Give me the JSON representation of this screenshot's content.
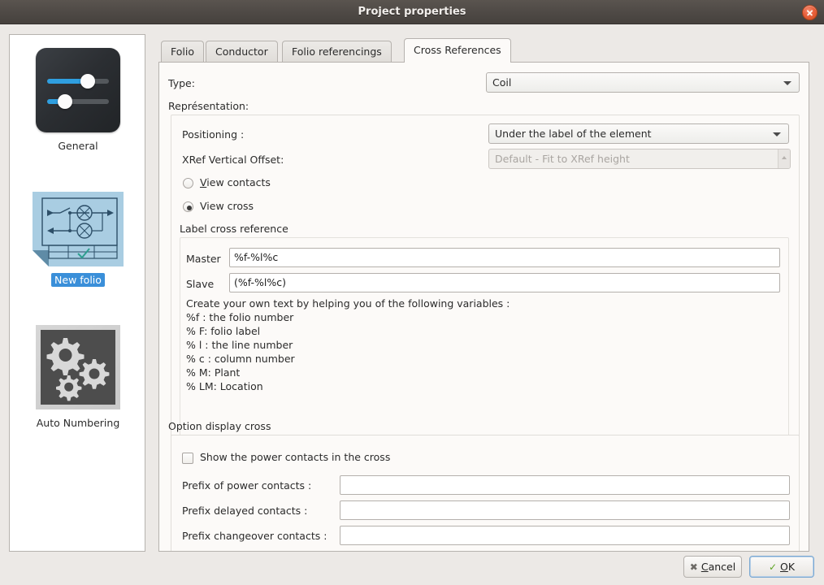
{
  "window": {
    "title": "Project properties",
    "close_icon": "close-icon"
  },
  "sidebar": {
    "items": [
      {
        "label": "General",
        "icon": "sliders-icon",
        "selected": false
      },
      {
        "label": "New folio",
        "icon": "folio-diagram-icon",
        "selected": true
      },
      {
        "label": "Auto Numbering",
        "icon": "gears-icon",
        "selected": false
      }
    ]
  },
  "tabs": [
    {
      "label": "Folio",
      "active": false
    },
    {
      "label": "Conductor",
      "active": false
    },
    {
      "label": "Folio referencings",
      "active": false
    },
    {
      "label": "Cross References",
      "active": true
    }
  ],
  "cross_references": {
    "type_label": "Type:",
    "type_value": "Coil",
    "representation_label": "Représentation:",
    "positioning_label": "Positioning :",
    "positioning_value": "Under the label of the element",
    "xref_offset_label": "XRef Vertical Offset:",
    "xref_offset_placeholder": "Default - Fit to XRef height",
    "xref_offset_value": "",
    "radio_view_contacts": "View contacts",
    "radio_view_cross": "View cross",
    "label_cross_reference_title": "Label cross reference",
    "master_label": "Master",
    "master_value": "%f-%l%c",
    "slave_label": "Slave",
    "slave_value": "(%f-%l%c)",
    "help_lines": [
      "Create your own text by helping you of the following variables :",
      "%f : the folio number",
      "% F: folio label",
      "% l : the line number",
      "% c : column number",
      "% M: Plant",
      "% LM: Location"
    ],
    "option_display_cross_title": "Option display cross",
    "show_power_contacts_label": "Show the power contacts in the cross",
    "prefix_power_label": "Prefix of power contacts :",
    "prefix_power_value": "",
    "prefix_delayed_label": "Prefix delayed contacts :",
    "prefix_delayed_value": "",
    "prefix_changeover_label": "Prefix changeover contacts :",
    "prefix_changeover_value": ""
  },
  "buttons": {
    "cancel_pre": "",
    "cancel_mnemonic": "C",
    "cancel_post": "ancel",
    "ok_mnemonic": "O",
    "ok_post": "K"
  },
  "colors": {
    "titlebar": "#4e4945",
    "close": "#e8603d",
    "selection": "#3a8fd9",
    "accent_slider": "#2f9fe0",
    "page_bg": "#fcfaf8",
    "dialog_bg": "#ece9e6",
    "check_green": "#5ea524"
  }
}
